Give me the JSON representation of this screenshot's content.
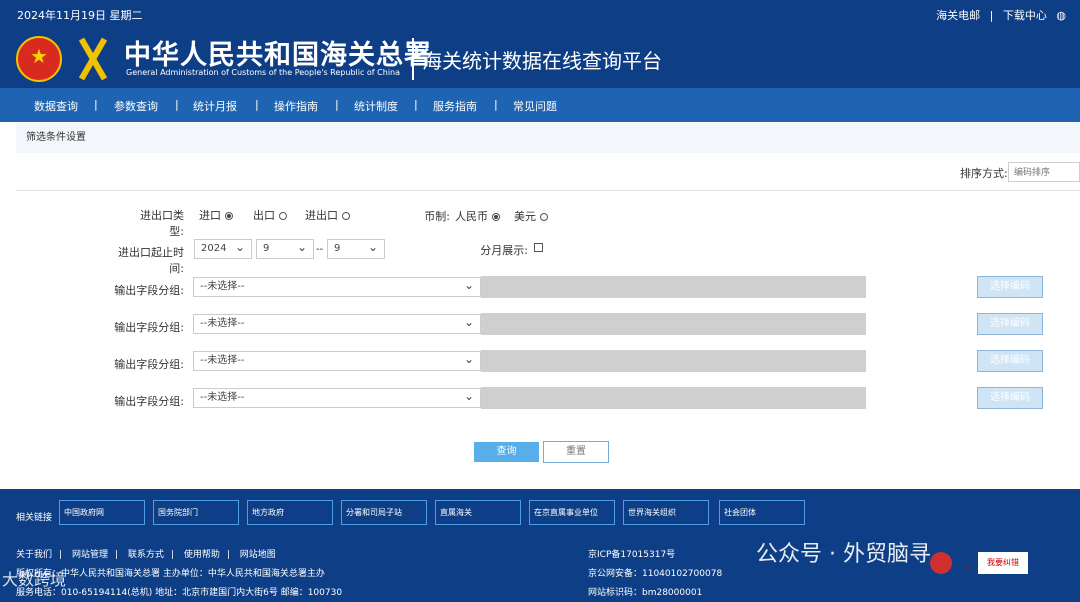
{
  "header": {
    "date": "2024年11月19日 星期二",
    "links": [
      "海关电邮",
      "下载中心"
    ],
    "weibo_icon": "weibo-icon",
    "title_cn": "中华人民共和国海关总署",
    "title_en": "General Administration of Customs of the People's Republic of China",
    "platform": "海关统计数据在线查询平台"
  },
  "nav": [
    "数据查询",
    "参数查询",
    "统计月报",
    "操作指南",
    "统计制度",
    "服务指南",
    "常见问题"
  ],
  "filter": {
    "title": "筛选条件设置",
    "sort_label": "排序方式:",
    "sort_placeholder": "编码排序",
    "trade_type_label": "进出口类型:",
    "trade_options": [
      "进口",
      "出口",
      "进出口"
    ],
    "currency_label": "币制:",
    "currency_options": [
      "人民币",
      "美元"
    ],
    "time_label": "进出口起止时间:",
    "year": "2024",
    "start_month": "9",
    "end_month": "9",
    "dash": "--",
    "monthly_label": "分月展示:",
    "field_label": "输出字段分组:",
    "field_placeholder": "--未选择--",
    "choose_code": "选择编码"
  },
  "buttons": {
    "query": "查询",
    "reset": "重置"
  },
  "footer": {
    "related_label": "相关链接",
    "related": [
      "中国政府网",
      "国务院部门",
      "地方政府",
      "分署和司局子站",
      "直属海关",
      "在京直属事业单位",
      "世界海关组织",
      "社会团体"
    ],
    "bottom_links": [
      "关于我们",
      "网站管理",
      "联系方式",
      "使用帮助",
      "网站地图"
    ],
    "line1": "版权所有：中华人民共和国海关总署   主办单位：中华人民共和国海关总署主办",
    "line2": "服务电话：010-65194114(总机)  地址：北京市建国门内大街6号  邮编：100730",
    "icp": "京ICP备17015317号",
    "police": "京公网安备：11040102700078",
    "site_code": "网站标识码：bm28000001",
    "watermark": "公众号 · 外贸脑寻",
    "left_watermark": "大数跨境",
    "badge": "我要纠错"
  }
}
